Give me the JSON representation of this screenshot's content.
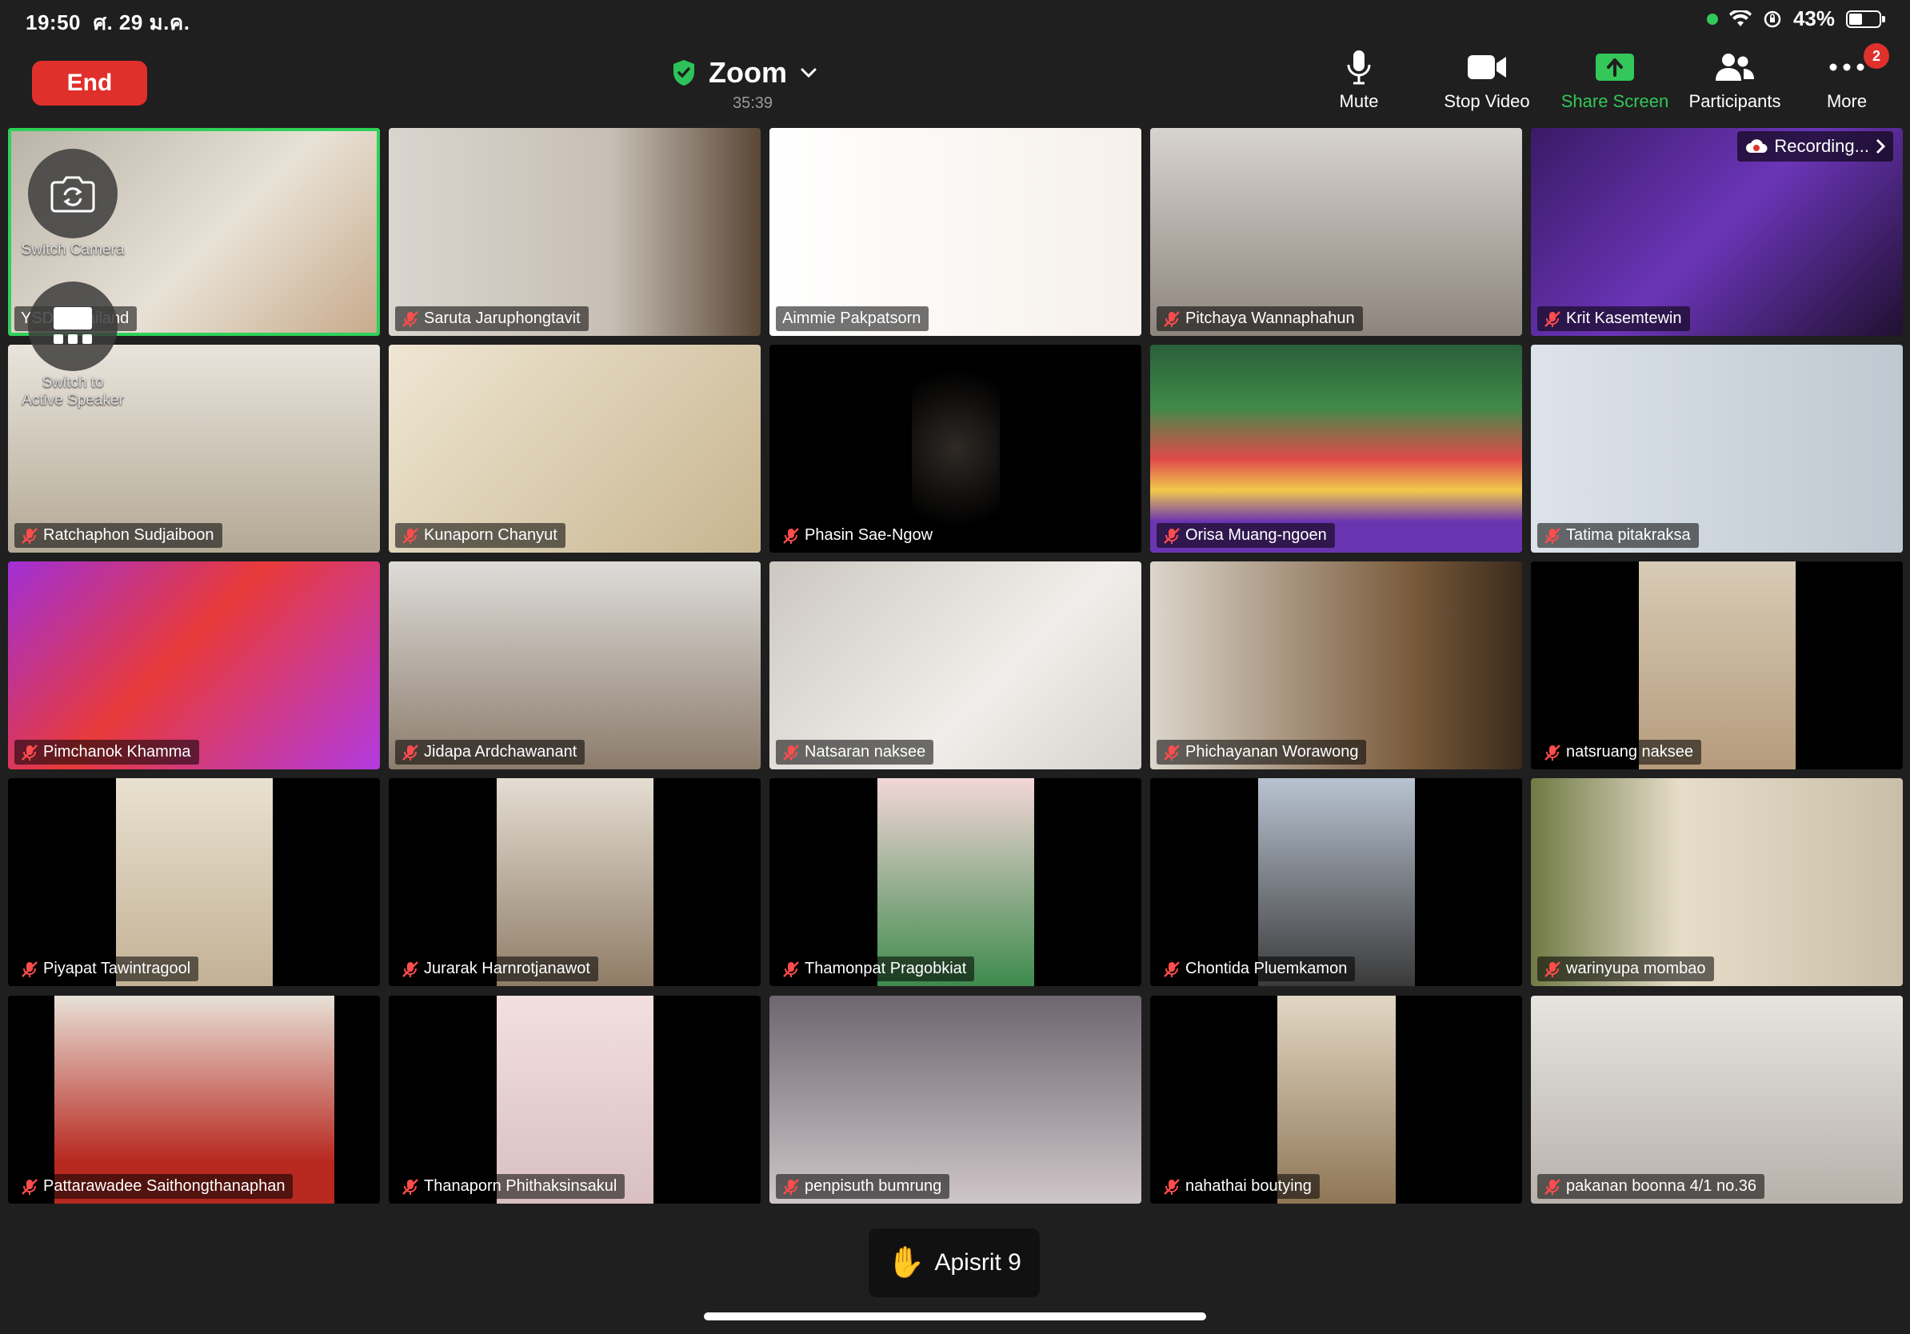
{
  "status": {
    "time": "19:50",
    "date": "ศ. 29 ม.ค.",
    "battery": "43%",
    "battery_level": 0.43,
    "icons": [
      "wifi-icon",
      "orientation-lock-icon",
      "battery-icon"
    ]
  },
  "header": {
    "end_label": "End",
    "title": "Zoom",
    "timer": "35:39"
  },
  "toolbar": {
    "mute": "Mute",
    "stop_video": "Stop Video",
    "share_screen": "Share Screen",
    "participants": "Participants",
    "more": "More",
    "more_badge": "2"
  },
  "recording": {
    "label": "Recording..."
  },
  "overlay": {
    "switch_camera": "Switch Camera",
    "switch_speaker_line1": "Switch to",
    "switch_speaker_line2": "Active Speaker"
  },
  "participants": [
    {
      "name": "YSDA Thailand",
      "muted": false,
      "active": true
    },
    {
      "name": "Saruta Jaruphongtavit",
      "muted": true
    },
    {
      "name": "Aimmie Pakpatsorn",
      "muted": false
    },
    {
      "name": "Pitchaya Wannaphahun",
      "muted": true
    },
    {
      "name": "Krit Kasemtewin",
      "muted": true
    },
    {
      "name": "Ratchaphon Sudjaiboon",
      "muted": true
    },
    {
      "name": "Kunaporn Chanyut",
      "muted": true
    },
    {
      "name": "Phasin Sae-Ngow",
      "muted": true
    },
    {
      "name": "Orisa Muang-ngoen",
      "muted": true
    },
    {
      "name": "Tatima pitakraksa",
      "muted": true
    },
    {
      "name": "Pimchanok Khamma",
      "muted": true
    },
    {
      "name": "Jidapa Ardchawanant",
      "muted": true
    },
    {
      "name": "Natsaran naksee",
      "muted": true
    },
    {
      "name": "Phichayanan Worawong",
      "muted": true
    },
    {
      "name": "natsruang naksee",
      "muted": true
    },
    {
      "name": "Piyapat Tawintragool",
      "muted": true
    },
    {
      "name": "Jurarak Harnrotjanawot",
      "muted": true
    },
    {
      "name": "Thamonpat Pragobkiat",
      "muted": true
    },
    {
      "name": "Chontida Pluemkamon",
      "muted": true
    },
    {
      "name": "warinyupa mombao",
      "muted": true
    },
    {
      "name": "Pattarawadee Saithongthanaphan",
      "muted": true
    },
    {
      "name": "Thanaporn Phithaksinsakul",
      "muted": true
    },
    {
      "name": "penpisuth bumrung",
      "muted": true
    },
    {
      "name": "nahathai boutying",
      "muted": true
    },
    {
      "name": "pakanan boonna 4/1 no.36",
      "muted": true
    }
  ],
  "raised_hand": {
    "label": "Apisrit 9"
  },
  "colors": {
    "end_red": "#e0302b",
    "share_green": "#34c759",
    "active_border": "#2ed158",
    "background": "#1f1f1f"
  }
}
